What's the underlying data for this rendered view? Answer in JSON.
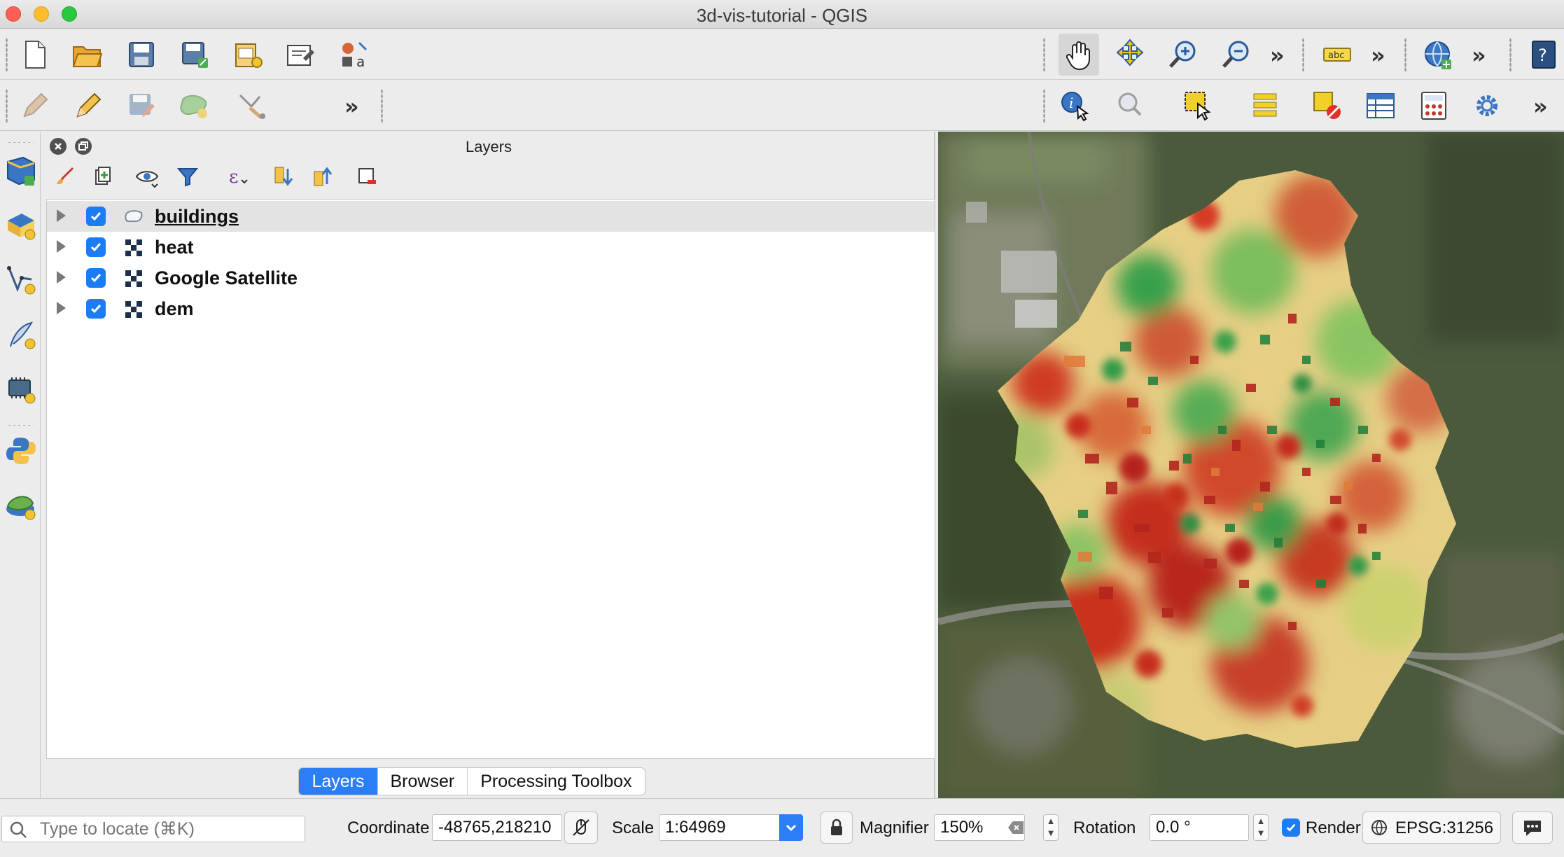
{
  "window": {
    "title": "3d-vis-tutorial - QGIS"
  },
  "toolbar_top": {
    "icons": [
      "new-project",
      "open-project",
      "save-project",
      "save-as",
      "print-layout",
      "layout-manager",
      "style-manager",
      "pan",
      "pan-to-selection",
      "zoom-in",
      "zoom-out",
      "label",
      "add-wms-layer",
      "help"
    ],
    "label_icon_text": "abc"
  },
  "toolbar_second": {
    "icons": [
      "edit-pencil",
      "toggle-editing",
      "save-edits",
      "digitize-polygon",
      "vertex-tool",
      "identify",
      "map-tips",
      "select-features",
      "attribute-selection",
      "deselect",
      "attribute-table",
      "field-calculator",
      "processing-settings"
    ]
  },
  "left_toolbar": {
    "icons": [
      "add-vector-layer",
      "add-raster-layer",
      "add-spatialite",
      "add-delimited-text",
      "add-gpx",
      "python-console",
      "add-mesh-layer"
    ]
  },
  "layers_panel": {
    "title": "Layers",
    "layers": [
      {
        "name": "buildings",
        "checked": true,
        "type": "vector-polygon",
        "selected": true
      },
      {
        "name": "heat",
        "checked": true,
        "type": "raster"
      },
      {
        "name": "Google Satellite",
        "checked": true,
        "type": "raster"
      },
      {
        "name": "dem",
        "checked": true,
        "type": "raster"
      }
    ],
    "tabs": [
      "Layers",
      "Browser",
      "Processing Toolbox"
    ],
    "active_tab": "Layers"
  },
  "status_bar": {
    "locator_placeholder": "Type to locate (⌘K)",
    "coordinate_label": "Coordinate",
    "coordinate_value": "-48765,218210",
    "scale_label": "Scale",
    "scale_value": "1:64969",
    "magnifier_label": "Magnifier",
    "magnifier_value": "150%",
    "rotation_label": "Rotation",
    "rotation_value": "0.0 °",
    "render_label": "Render",
    "render_checked": true,
    "crs": "EPSG:31256"
  },
  "colors": {
    "accent": "#2b7ef6",
    "heat_red": "#c8261c",
    "heat_orange": "#e8823c",
    "heat_yellow": "#e7d98a",
    "heat_green": "#2e9a48"
  }
}
